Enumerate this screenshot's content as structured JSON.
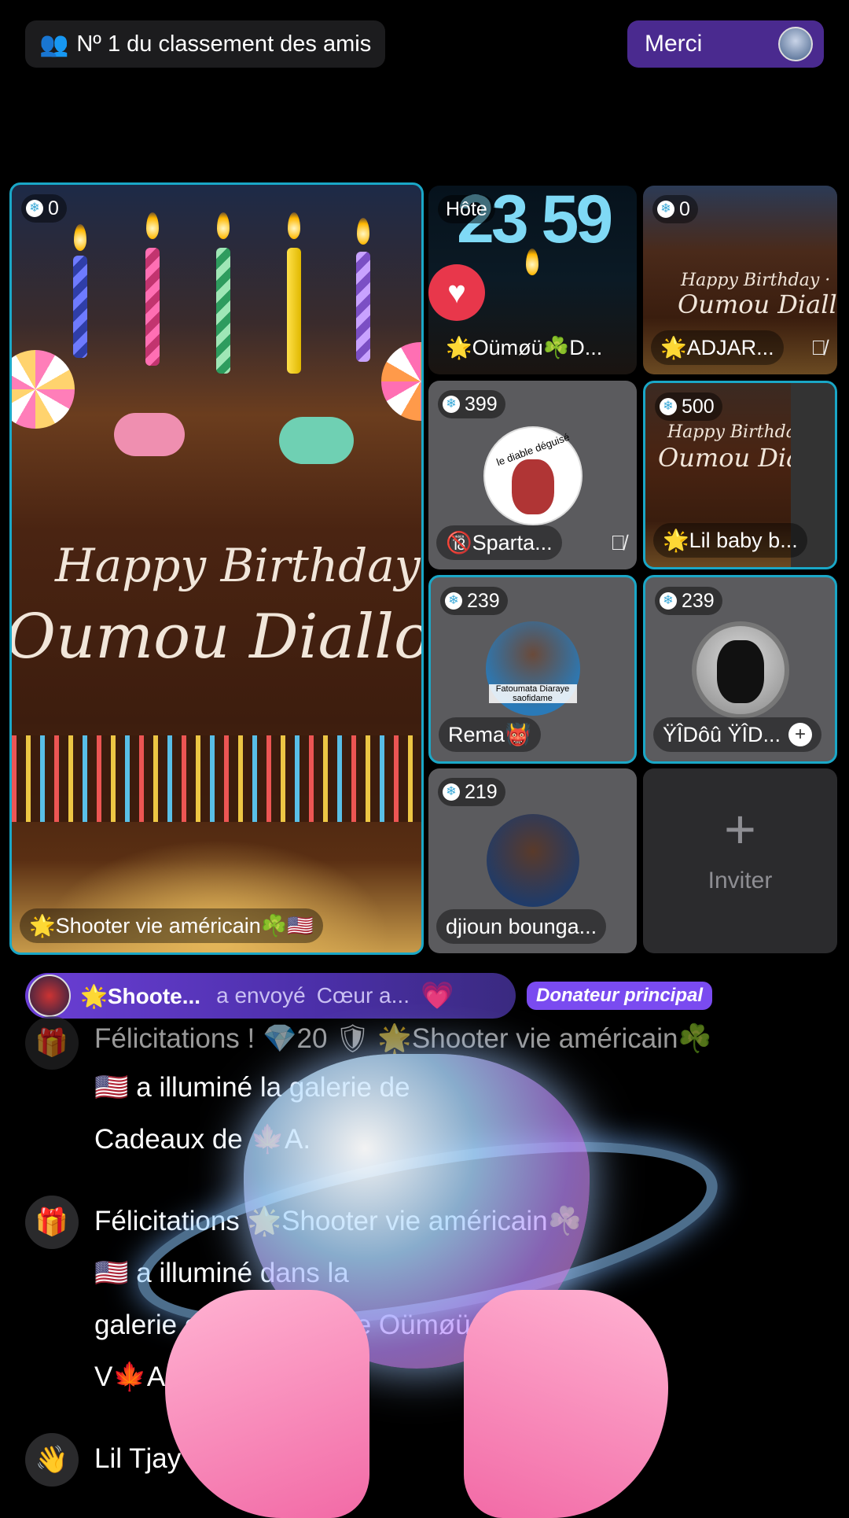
{
  "top": {
    "ranking_label": "Nº 1 du classement des amis",
    "thanks_label": "Merci"
  },
  "host_tile": {
    "count": "0",
    "cake_line1": "Happy Birthday ·",
    "cake_line2": "Oumou Diallo",
    "name": "🌟Shooter vie américain☘️🇺🇸"
  },
  "tiles": [
    {
      "count": "",
      "badge": "Hôte",
      "clock": "23 59",
      "name": "🌟Oümøü☘️D..."
    },
    {
      "count": "0",
      "cake_line1": "Happy Birthday ·",
      "cake_line2": "Oumou Diallo",
      "name": "🌟ADJAR..."
    },
    {
      "count": "399",
      "avatar_text": "le diable déguisé",
      "name": "🔞Sparta..."
    },
    {
      "count": "500",
      "cake_line1": "Happy Birthday ·",
      "cake_line2": "Oumou Diallo",
      "name": "🌟Lil baby b..."
    },
    {
      "count": "239",
      "avatar_caption": "Fatoumata Diaraye saofidame",
      "name": "Rema👹"
    },
    {
      "count": "239",
      "name": "ŸÎDôû ŸÎD..."
    },
    {
      "count": "219",
      "name": "djioun bounga..."
    }
  ],
  "invite_label": "Inviter",
  "gift_bar": {
    "sender": "🌟Shoote...",
    "action": "a envoyé",
    "gift": "Cœur a...",
    "donor_badge": "Donateur principal"
  },
  "chat": [
    {
      "lines": [
        "Félicitations ! 💎20 🛡 🌟Shooter vie américain☘️",
        "🇺🇸 a illuminé la galerie de",
        "Cadeaux de 🍁A."
      ]
    },
    {
      "lines": [
        "Félicitations 🌟Shooter vie américain☘️",
        "🇺🇸 a illuminé dans la",
        "galerie de Cadeaux de Oümøü elløᅠ🍂S🌿",
        "V🍁A."
      ]
    },
    {
      "lines": [
        "Lil Tjay a rejoint"
      ]
    }
  ],
  "colors": {
    "accent_purple": "#4a2a8f",
    "highlight_border": "#1aa7c7",
    "donor_badge": "#7a4bf0"
  }
}
